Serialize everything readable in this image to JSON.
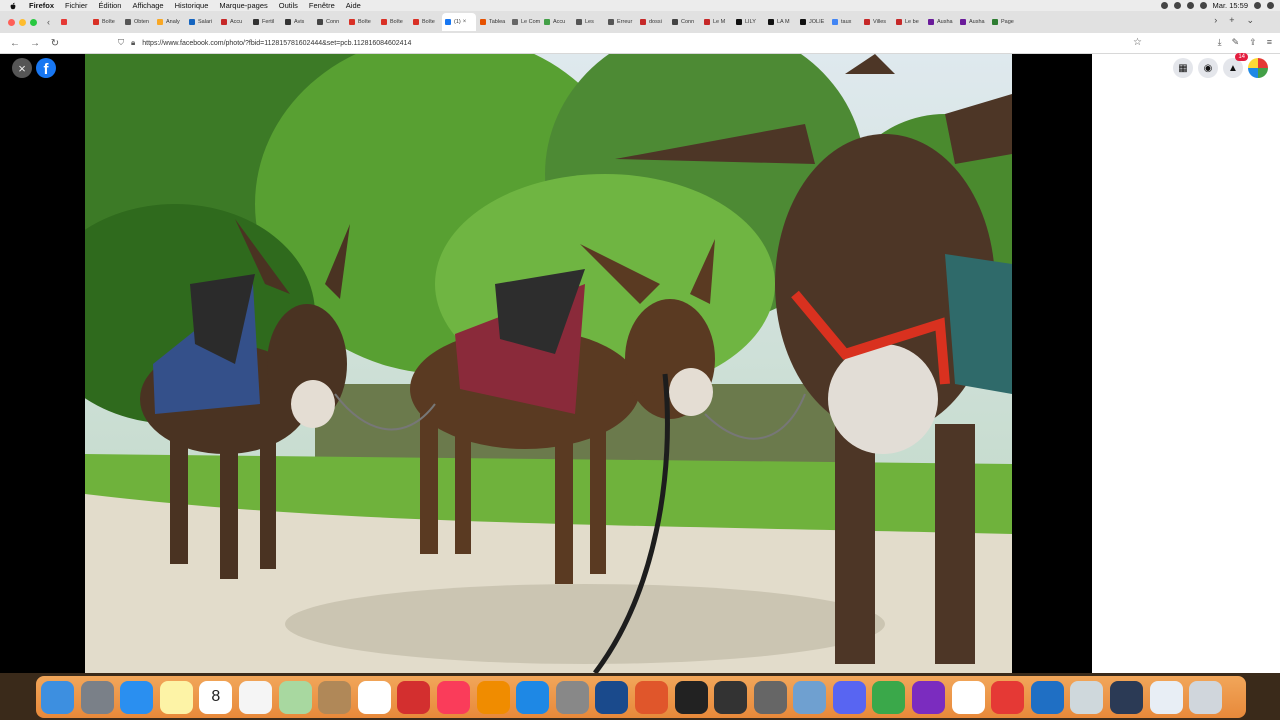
{
  "menubar": {
    "app_name": "Firefox",
    "menus": [
      "Fichier",
      "Édition",
      "Affichage",
      "Historique",
      "Marque-pages",
      "Outils",
      "Fenêtre",
      "Aide"
    ],
    "clock": "Mar. 15:59"
  },
  "tabs": [
    {
      "label": "",
      "color": "#e53935"
    },
    {
      "label": "Boîte",
      "color": "#d93025"
    },
    {
      "label": "Obten",
      "color": "#555555"
    },
    {
      "label": "Analy",
      "color": "#f9a825"
    },
    {
      "label": "Salari",
      "color": "#1565c0"
    },
    {
      "label": "Accu",
      "color": "#c62828"
    },
    {
      "label": "Fertil",
      "color": "#333333"
    },
    {
      "label": "Avis",
      "color": "#333333"
    },
    {
      "label": "Conn",
      "color": "#444444"
    },
    {
      "label": "Boîte",
      "color": "#d93025"
    },
    {
      "label": "Boîte",
      "color": "#d93025"
    },
    {
      "label": "Boîte",
      "color": "#d93025"
    },
    {
      "label": "(1)",
      "color": "#1877f2",
      "active": true
    },
    {
      "label": "Tablea",
      "color": "#e65100"
    },
    {
      "label": "Le Comité",
      "color": "#666666"
    },
    {
      "label": "Accu",
      "color": "#43a047"
    },
    {
      "label": "Les",
      "color": "#555555"
    },
    {
      "label": "Erreur",
      "color": "#555555"
    },
    {
      "label": "dossi",
      "color": "#c62828"
    },
    {
      "label": "Conn",
      "color": "#444444"
    },
    {
      "label": "Le M",
      "color": "#c62828"
    },
    {
      "label": "LILY",
      "color": "#111111"
    },
    {
      "label": "LA M",
      "color": "#111111"
    },
    {
      "label": "JOLIE",
      "color": "#111111"
    },
    {
      "label": "taux",
      "color": "#4285f4"
    },
    {
      "label": "Villes",
      "color": "#c62828"
    },
    {
      "label": "Le be",
      "color": "#c62828"
    },
    {
      "label": "Ausha",
      "color": "#6a1b9a"
    },
    {
      "label": "Ausha",
      "color": "#6a1b9a"
    },
    {
      "label": "Page",
      "color": "#2e7d32"
    }
  ],
  "url": "https://www.facebook.com/photo/?fbid=112815781602444&set=pcb.112816084602414",
  "facebook": {
    "logo": "f",
    "notification_count": "14"
  },
  "icons": {
    "close": "×",
    "back": "←",
    "forward": "→",
    "reload": "↻",
    "star": "☆",
    "grid": "▦",
    "messenger": "◉",
    "bell": "🔔"
  },
  "dock": [
    {
      "name": "finder-icon",
      "bg": "#3d8fe0"
    },
    {
      "name": "launchpad-icon",
      "bg": "#7a8088"
    },
    {
      "name": "safari-icon",
      "bg": "#2a8ff0"
    },
    {
      "name": "notes-icon",
      "bg": "#fdf3a6"
    },
    {
      "name": "calendar-icon",
      "bg": "#ffffff",
      "label": "8"
    },
    {
      "name": "reminders-icon",
      "bg": "#f5f5f5"
    },
    {
      "name": "maps-icon",
      "bg": "#a8d8a0"
    },
    {
      "name": "contacts-icon",
      "bg": "#b08858"
    },
    {
      "name": "photos-icon",
      "bg": "#ffffff"
    },
    {
      "name": "acrobat-icon",
      "bg": "#d32f2f"
    },
    {
      "name": "music-icon",
      "bg": "#fa3c5a"
    },
    {
      "name": "books-icon",
      "bg": "#f08c00"
    },
    {
      "name": "app-store-icon",
      "bg": "#1e88e5"
    },
    {
      "name": "system-preferences-icon",
      "bg": "#888888"
    },
    {
      "name": "globe-icon",
      "bg": "#1a4a8c"
    },
    {
      "name": "firefox-icon",
      "bg": "#e0562b"
    },
    {
      "name": "final-cut-icon",
      "bg": "#222222"
    },
    {
      "name": "dvd-icon",
      "bg": "#333333"
    },
    {
      "name": "calculator-icon",
      "bg": "#666666"
    },
    {
      "name": "preview-icon",
      "bg": "#6fa0d0"
    },
    {
      "name": "discord-icon",
      "bg": "#5865f2"
    },
    {
      "name": "money-icon",
      "bg": "#3aa84a"
    },
    {
      "name": "podcast-headphones-icon",
      "bg": "#7b2cbf"
    },
    {
      "name": "audio-wave-icon",
      "bg": "#ffffff"
    },
    {
      "name": "first-aid-icon",
      "bg": "#e53935"
    },
    {
      "name": "airline-icon",
      "bg": "#1f6fc4"
    },
    {
      "name": "archive-box-icon",
      "bg": "#cfd8dc"
    },
    {
      "name": "quicktime-icon",
      "bg": "#2b3a55"
    },
    {
      "name": "music-folder-icon",
      "bg": "#e8eef5"
    },
    {
      "name": "trash-icon",
      "bg": "#d0d6dc"
    }
  ]
}
